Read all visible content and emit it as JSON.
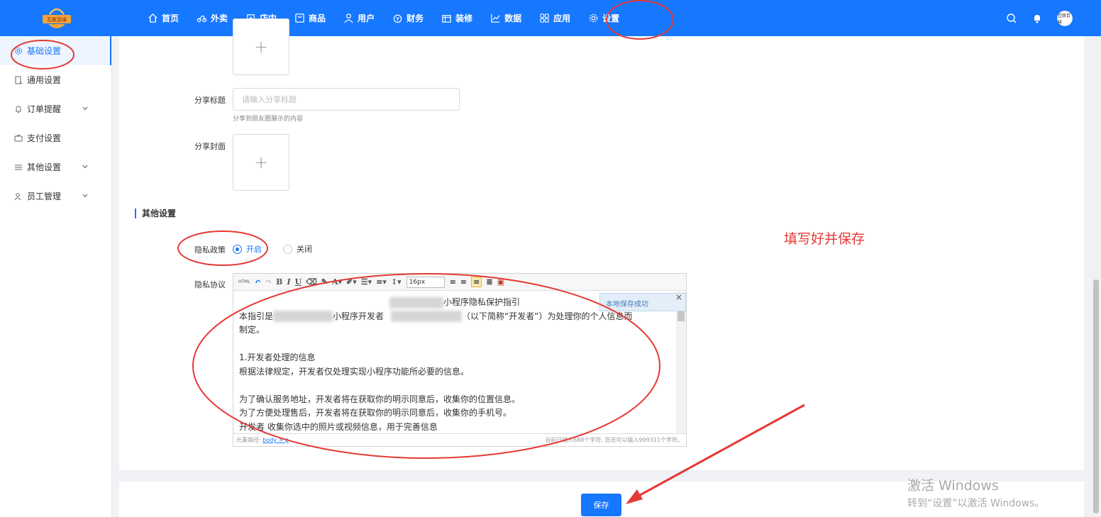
{
  "topbar": {
    "logo_text": "互联百味",
    "nav": [
      {
        "label": "首页",
        "icon": "home-icon"
      },
      {
        "label": "外卖",
        "icon": "takeout-icon"
      },
      {
        "label": "店内",
        "icon": "store-icon"
      },
      {
        "label": "商品",
        "icon": "goods-icon"
      },
      {
        "label": "用户",
        "icon": "user-icon"
      },
      {
        "label": "财务",
        "icon": "finance-icon"
      },
      {
        "label": "装修",
        "icon": "decorate-icon"
      },
      {
        "label": "数据",
        "icon": "chart-icon"
      },
      {
        "label": "应用",
        "icon": "apps-icon"
      },
      {
        "label": "设置",
        "icon": "gear-icon"
      }
    ],
    "avatar_text": "互联百味",
    "brand_color": "#1677ff"
  },
  "sidebar": {
    "items": [
      {
        "label": "基础设置",
        "icon": "gear-icon",
        "active": true
      },
      {
        "label": "通用设置",
        "icon": "doc-icon"
      },
      {
        "label": "订单提醒",
        "icon": "bell-icon",
        "expandable": true
      },
      {
        "label": "支付设置",
        "icon": "wallet-icon"
      },
      {
        "label": "其他设置",
        "icon": "list-icon",
        "expandable": true
      },
      {
        "label": "员工管理",
        "icon": "staff-icon",
        "expandable": true
      }
    ]
  },
  "form": {
    "share_title_label": "分享标题",
    "share_title_placeholder": "请输入分享标题",
    "share_title_hint": "分享到朋友圈展示的内容",
    "share_cover_label": "分享封面",
    "upload_plus": "+",
    "other_section_title": "其他设置",
    "privacy_label": "隐私政策",
    "privacy_on": "开启",
    "privacy_off": "关闭",
    "agreement_label": "隐私协议"
  },
  "editor": {
    "font_size": "16px",
    "html_btn": "HTML",
    "toast": "本地保存成功",
    "toast_close": "×",
    "title_suffix": "小程序隐私保护指引",
    "line1_a": "本指引是",
    "line1_b": "小程序开发者",
    "line1_c": "（以下简称“开发者”）为处理你的个人信息而",
    "line2": "制定。",
    "line3": "1.开发者处理的信息",
    "line4": "根据法律规定，开发者仅处理实现小程序功能所必要的信息。",
    "line5": "为了确认服务地址，开发者将在获取你的明示同意后，收集你的位置信息。",
    "line6": "为了方便处理售后，开发者将在获取你的明示同意后，收集你的手机号。",
    "line7": "开发者 收集你选中的照片或视频信息，用于完善信息",
    "path_label": "元素路径:",
    "path_value": "body > p",
    "counter": "当前已输入688个字符, 您还可以输入999311个字符。"
  },
  "save_label": "保存",
  "annotation_text": "填写好并保存",
  "activate": {
    "line1": "激活 Windows",
    "line2": "转到“设置”以激活 Windows。"
  },
  "colors": {
    "annotation": "#e53935",
    "accent": "#1677ff"
  }
}
